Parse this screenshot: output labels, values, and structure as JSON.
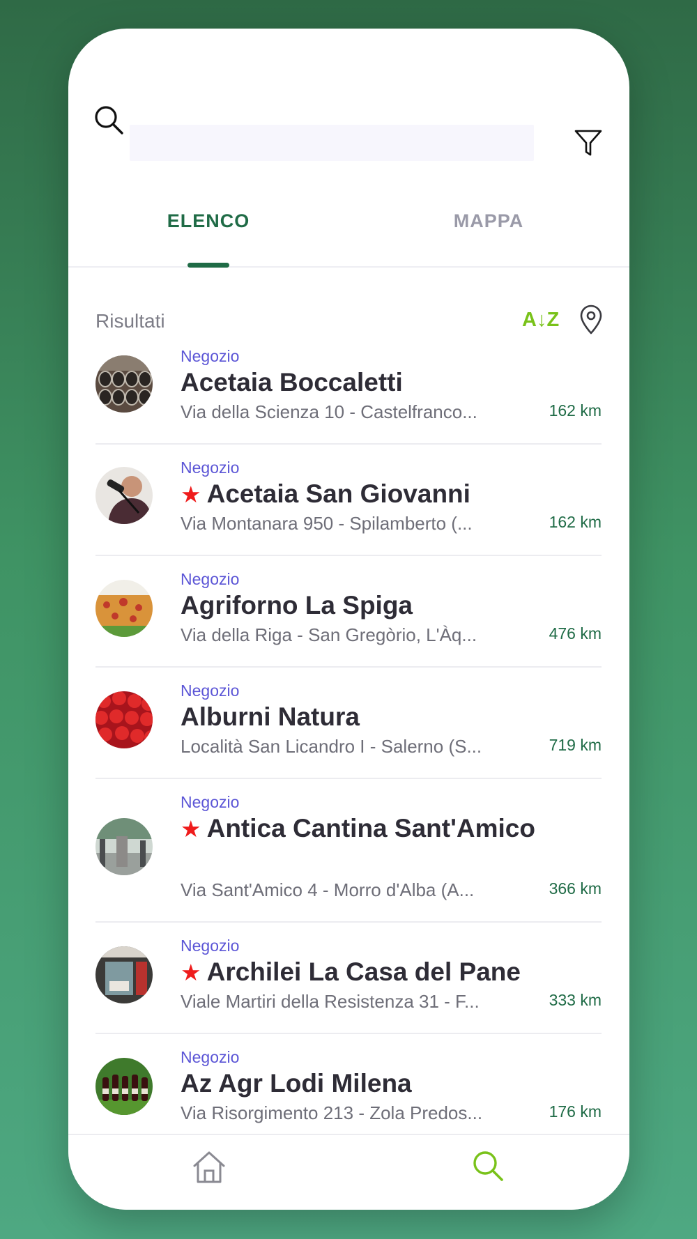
{
  "search": {
    "value": "",
    "placeholder": ""
  },
  "tabs": [
    {
      "label": "ELENCO",
      "active": true
    },
    {
      "label": "MAPPA",
      "active": false
    }
  ],
  "results": {
    "label": "Risultati",
    "sort_label": "A↓Z"
  },
  "items": [
    {
      "category": "Negozio",
      "name": "Acetaia Boccaletti",
      "starred": false,
      "address": "Via della Scienza 10 - Castelfranco...",
      "distance": "162 km",
      "image": "barrels"
    },
    {
      "category": "Negozio",
      "name": "Acetaia San Giovanni",
      "starred": true,
      "address": "Via Montanara 950 - Spilamberto (...",
      "distance": "162 km",
      "image": "person"
    },
    {
      "category": "Negozio",
      "name": "Agriforno La Spiga",
      "starred": false,
      "address": "Via della Riga - San Gregòrio, L'Àq...",
      "distance": "476 km",
      "image": "pizza"
    },
    {
      "category": "Negozio",
      "name": "Alburni Natura",
      "starred": false,
      "address": "Località San Licandro I - Salerno (S...",
      "distance": "719 km",
      "image": "strawberries"
    },
    {
      "category": "Negozio",
      "name": "Antica Cantina Sant'Amico",
      "starred": true,
      "address": "Via Sant'Amico 4 - Morro d'Alba (A...",
      "distance": "366 km",
      "image": "winery"
    },
    {
      "category": "Negozio",
      "name": "Archilei La Casa del Pane",
      "starred": true,
      "address": "Viale Martiri della Resistenza 31 - F...",
      "distance": "333 km",
      "image": "shopfront"
    },
    {
      "category": "Negozio",
      "name": "Az Agr Lodi Milena",
      "starred": false,
      "address": "Via Risorgimento 213 - Zola Predos...",
      "distance": "176 km",
      "image": "bottles"
    }
  ],
  "nav": {
    "home_icon": "home-icon",
    "search_icon": "search-icon"
  },
  "colors": {
    "primary": "#1f6b46",
    "accent": "#79c21a",
    "category": "#5b55d6",
    "star": "#ef1c1c"
  }
}
